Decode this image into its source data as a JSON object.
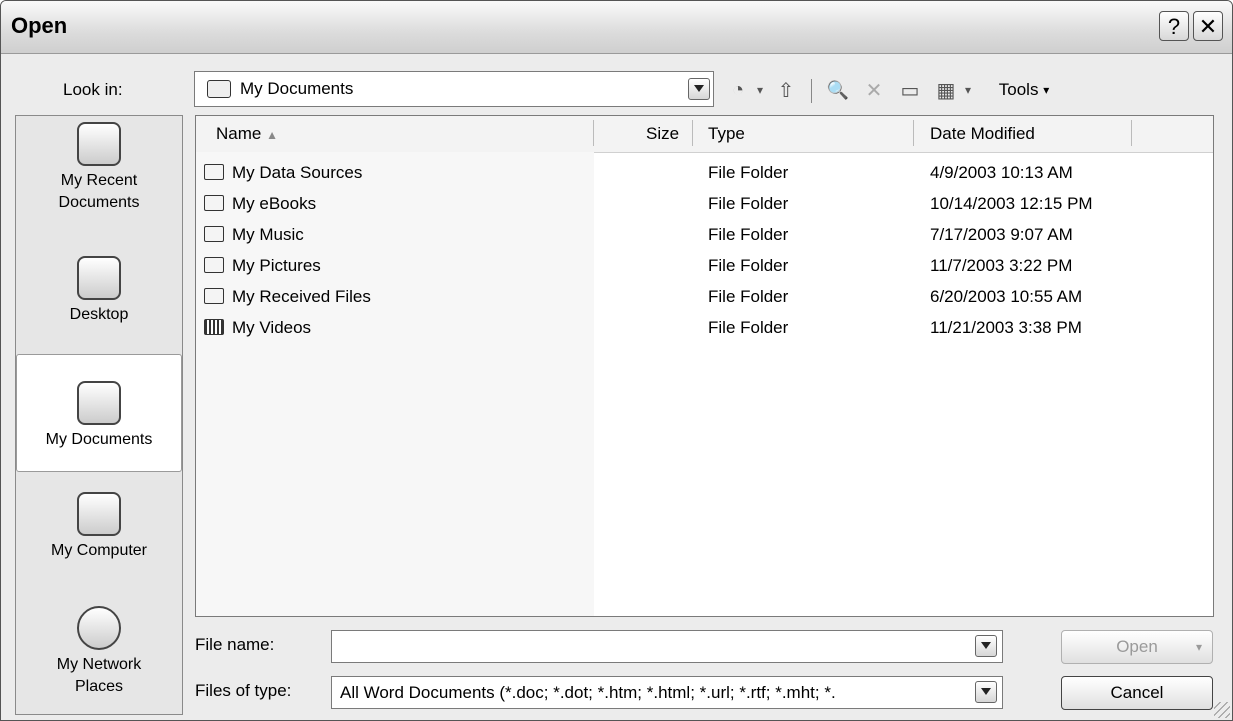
{
  "window": {
    "title": "Open",
    "help_glyph": "?",
    "close_glyph": "✕"
  },
  "look_in": {
    "label": "Look in:",
    "value": "My Documents"
  },
  "toolbar": {
    "back_glyph": "◔",
    "up_glyph": "⇧",
    "search_glyph": "🔍",
    "delete_glyph": "✕",
    "new_folder_glyph": "▭",
    "views_glyph": "▦",
    "tools_label": "Tools"
  },
  "places": [
    {
      "line1": "My Recent",
      "line2": "Documents",
      "icon": "recent-documents-icon",
      "selected": false
    },
    {
      "line1": "Desktop",
      "line2": "",
      "icon": "desktop-icon",
      "selected": false
    },
    {
      "line1": "My Documents",
      "line2": "",
      "icon": "my-documents-icon",
      "selected": true
    },
    {
      "line1": "My Computer",
      "line2": "",
      "icon": "my-computer-icon",
      "selected": false
    },
    {
      "line1": "My Network",
      "line2": "Places",
      "icon": "network-places-icon",
      "selected": false
    }
  ],
  "columns": {
    "name": "Name",
    "size": "Size",
    "type": "Type",
    "date": "Date Modified"
  },
  "files": [
    {
      "name": "My Data Sources",
      "type": "File Folder",
      "date": "4/9/2003 10:13 AM",
      "icon": "data-sources-folder-icon"
    },
    {
      "name": "My eBooks",
      "type": "File Folder",
      "date": "10/14/2003 12:15 PM",
      "icon": "folder-icon"
    },
    {
      "name": "My Music",
      "type": "File Folder",
      "date": "7/17/2003 9:07 AM",
      "icon": "music-folder-icon"
    },
    {
      "name": "My Pictures",
      "type": "File Folder",
      "date": "11/7/2003 3:22 PM",
      "icon": "pictures-folder-icon"
    },
    {
      "name": "My Received Files",
      "type": "File Folder",
      "date": "6/20/2003 10:55 AM",
      "icon": "folder-icon"
    },
    {
      "name": "My Videos",
      "type": "File Folder",
      "date": "11/21/2003 3:38 PM",
      "icon": "videos-folder-icon"
    }
  ],
  "file_name": {
    "label": "File name:",
    "value": ""
  },
  "file_type": {
    "label": "Files of type:",
    "value": "All Word Documents (*.doc; *.dot; *.htm; *.html; *.url; *.rtf; *.mht; *."
  },
  "buttons": {
    "open": "Open",
    "cancel": "Cancel"
  }
}
